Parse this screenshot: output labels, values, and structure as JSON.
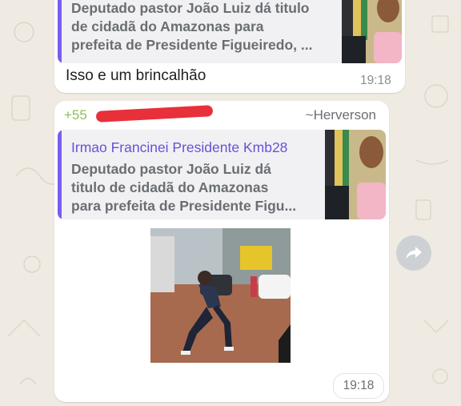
{
  "messages": [
    {
      "quote": {
        "text_lines": [
          "Deputado pastor João Luiz dá titulo",
          "de cidadã do Amazonas para",
          "prefeita de Presidente Figueiredo, ..."
        ]
      },
      "text": "Isso e um brincalhão",
      "time": "19:18"
    },
    {
      "sender_phone": "+55",
      "sender_name": "~Herverson",
      "quote": {
        "author": "Irmao Francinei Presidente Kmb28",
        "text_lines": [
          "Deputado pastor João Luiz dá",
          "titulo de cidadã do Amazonas",
          "para prefeita de Presidente Figu..."
        ]
      },
      "video_sign_text": "",
      "time": "19:18"
    }
  ],
  "colors": {
    "background": "#efeae2",
    "bubble": "#ffffff",
    "quote_bar": "#7a5cf0",
    "author": "#6b4fd9",
    "phone": "#8fbf5a",
    "redaction": "#e8303a"
  },
  "icons": {
    "forward": "forward-arrow-icon"
  }
}
